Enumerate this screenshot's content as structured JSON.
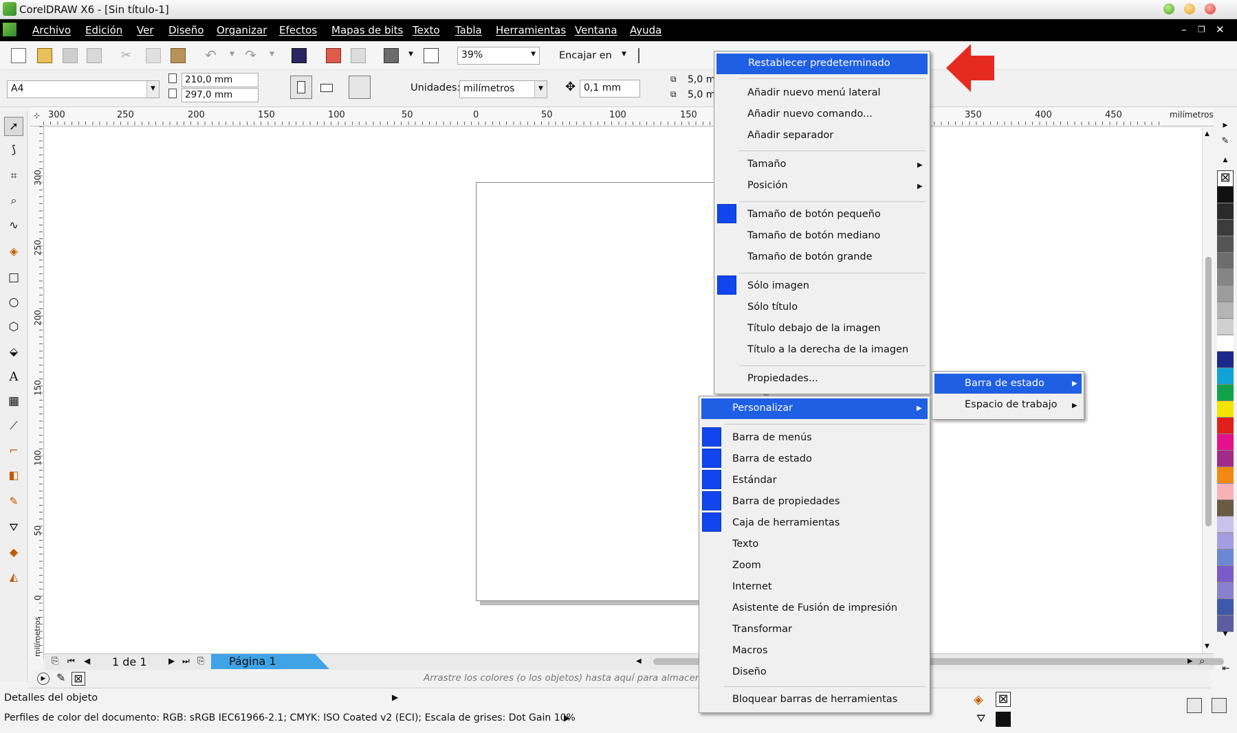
{
  "window": {
    "title": "CorelDRAW X6 - [Sin título-1]"
  },
  "menubar": {
    "items": [
      "Archivo",
      "Edición",
      "Ver",
      "Diseño",
      "Organizar",
      "Efectos",
      "Mapas de bits",
      "Texto",
      "Tabla",
      "Herramientas",
      "Ventana",
      "Ayuda"
    ]
  },
  "toolbar": {
    "zoom": "39%",
    "snap_label": "Encajar en"
  },
  "property_bar": {
    "page_size": "A4",
    "width": "210,0 mm",
    "height": "297,0 mm",
    "units_label": "Unidades:",
    "units_value": "milímetros",
    "nudge": "0,1 mm",
    "dup_x": "5,0 m",
    "dup_y": "5,0 m"
  },
  "ruler": {
    "h_labels": [
      "300",
      "250",
      "200",
      "150",
      "100",
      "50",
      "0",
      "50",
      "100",
      "150",
      "350",
      "400",
      "450"
    ],
    "h_unit": "milímetros",
    "v_labels": [
      "300",
      "250",
      "200",
      "150",
      "100",
      "50",
      "0"
    ],
    "v_unit": "milímetros"
  },
  "page_nav": {
    "counter": "1 de 1",
    "tab": "Página 1"
  },
  "docker_hint": "Arrastre los colores (o los objetos) hasta aquí para almacena",
  "status": {
    "object_details": "Detalles del objeto",
    "color_profiles": "Perfiles de color del documento: RGB: sRGB IEC61966-2.1; CMYK: ISO Coated v2 (ECI); Escala de grises: Dot Gain 10%"
  },
  "context_menu_top": {
    "reset": "Restablecer predeterminado",
    "add_flyout": "Añadir nuevo menú lateral",
    "add_command": "Añadir nuevo comando...",
    "add_separator": "Añadir separador",
    "size": "Tamaño",
    "position": "Posición",
    "btn_small": "Tamaño de botón pequeño",
    "btn_medium": "Tamaño de botón mediano",
    "btn_large": "Tamaño de botón grande",
    "only_image": "Sólo imagen",
    "only_title": "Sólo título",
    "title_below": "Título debajo de la imagen",
    "title_right": "Título a la derecha de la imagen",
    "properties": "Propiedades..."
  },
  "context_menu_bottom": {
    "customize": "Personalizar",
    "items": [
      "Barra de menús",
      "Barra de estado",
      "Estándar",
      "Barra de propiedades",
      "Caja de herramientas",
      "Texto",
      "Zoom",
      "Internet",
      "Asistente de Fusión de impresión",
      "Transformar",
      "Macros",
      "Diseño"
    ],
    "lock": "Bloquear barras de herramientas"
  },
  "submenu": {
    "status_bar": "Barra de estado",
    "workspace": "Espacio de trabajo"
  },
  "colors": {
    "accent": "#1e5fe3",
    "check": "#1146ef",
    "arrow": "#e52b20"
  }
}
